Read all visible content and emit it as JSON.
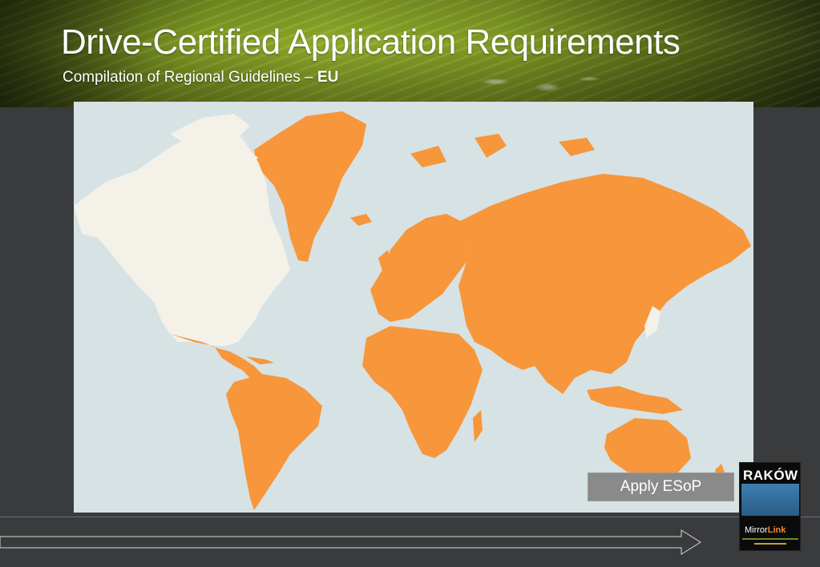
{
  "header": {
    "title": "Drive-Certified Application Requirements",
    "subtitle_prefix": "Compilation of Regional Guidelines – ",
    "subtitle_region": "EU"
  },
  "map": {
    "ocean_color": "#d6e2e4",
    "highlight_color": "#f7963a",
    "excluded_color": "#f3f1e8"
  },
  "apply_button": {
    "label": "Apply ESoP"
  },
  "logo": {
    "city_word": "RAKÓW",
    "brand_prefix": "Mirror",
    "brand_suffix": "Link"
  }
}
